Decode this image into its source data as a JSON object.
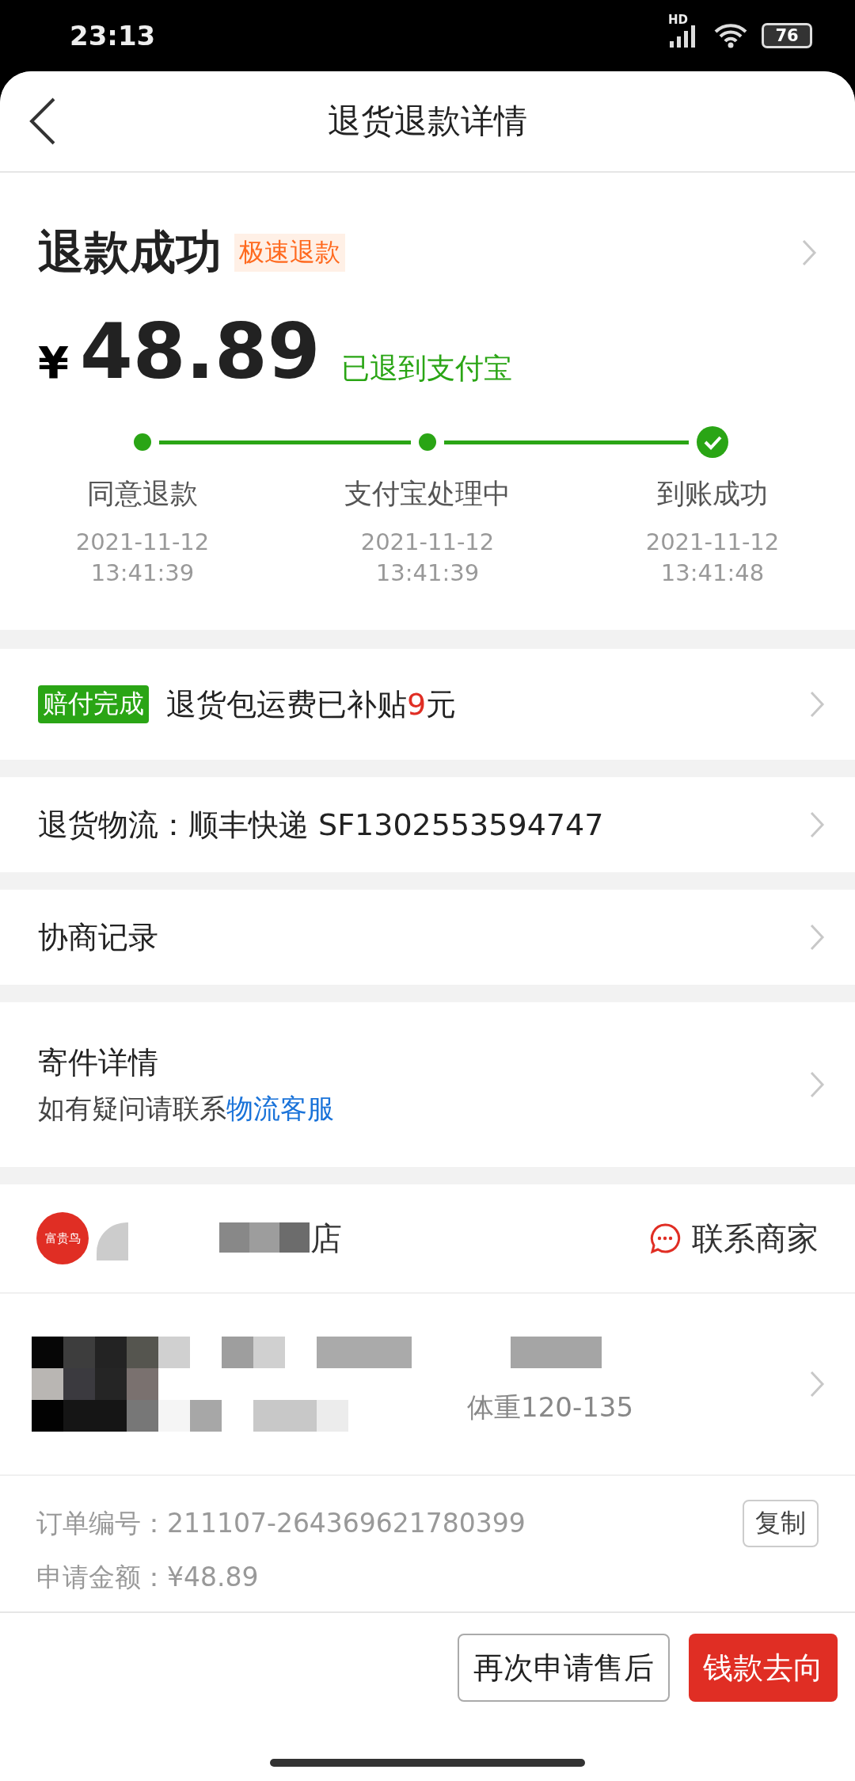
{
  "status_bar": {
    "time": "23:13",
    "network": "HD",
    "battery": "76"
  },
  "header": {
    "title": "退货退款详情"
  },
  "summary": {
    "status": "退款成功",
    "badge": "极速退款",
    "currency": "¥",
    "amount": "48.89",
    "destination": "已退到支付宝",
    "steps": [
      {
        "kind": "dot",
        "label": "同意退款",
        "date": "2021-11-12",
        "time": "13:41:39"
      },
      {
        "kind": "dot",
        "label": "支付宝处理中",
        "date": "2021-11-12",
        "time": "13:41:39"
      },
      {
        "kind": "check",
        "label": "到账成功",
        "date": "2021-11-12",
        "time": "13:41:48"
      }
    ]
  },
  "rows": [
    {
      "kind": "compensation",
      "badge": "赔付完成",
      "text_before": "退货包运费已补贴",
      "highlight": "9",
      "text_after": "元"
    },
    {
      "kind": "plain",
      "text": "退货物流：顺丰快递 SF1302553594747"
    },
    {
      "kind": "plain",
      "text": "协商记录"
    },
    {
      "kind": "subtitle",
      "text": "寄件详情",
      "subtitle": "如有疑问请联系",
      "link": "物流客服"
    }
  ],
  "store": {
    "logo_text": "富贵鸟",
    "name": "店",
    "contact": "联系商家"
  },
  "product": {
    "title_visible": "体重120-135"
  },
  "order": {
    "number_label": "订单编号：",
    "number": "211107-264369621780399",
    "copy": "复制",
    "amount_label": "申请金额：",
    "amount": "¥48.89"
  },
  "actions": [
    {
      "kind": "outline",
      "label": "再次申请售后"
    },
    {
      "kind": "primary",
      "label": "钱款去向"
    }
  ]
}
